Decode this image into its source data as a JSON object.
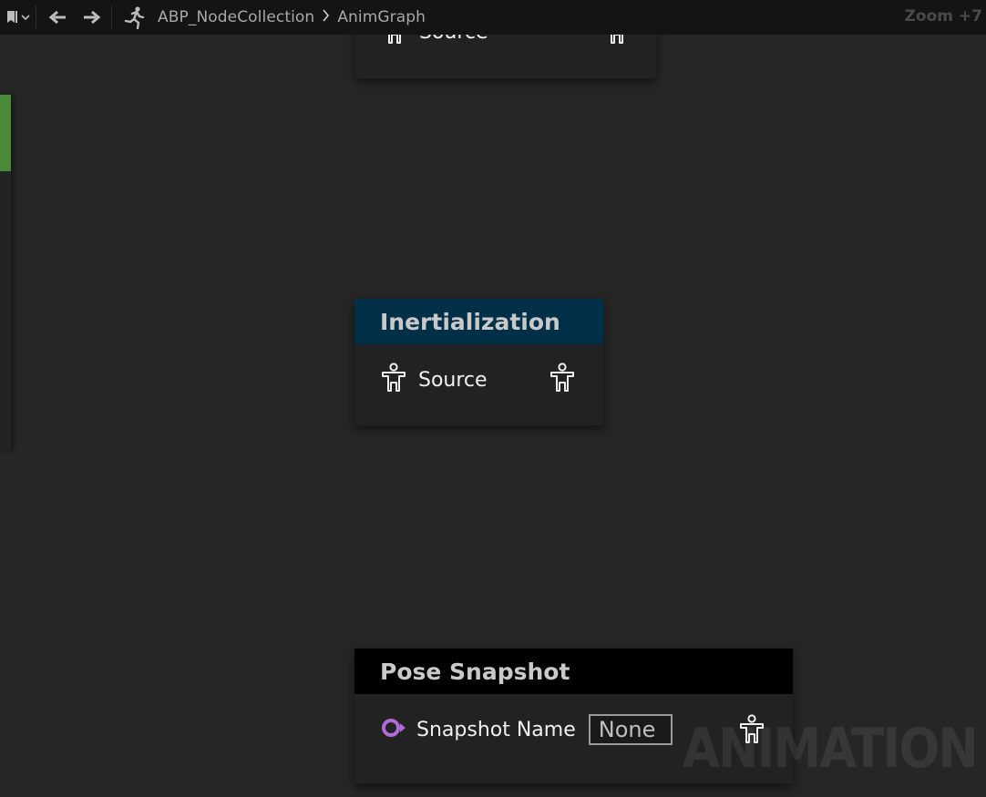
{
  "toolbar": {
    "breadcrumb_root": "ABP_NodeCollection",
    "breadcrumb_separator": ">",
    "breadcrumb_current": "AnimGraph",
    "zoom_label": "Zoom +7"
  },
  "nodes": {
    "top_partial": {
      "pin_label": "Source"
    },
    "inertialization": {
      "title": "Inertialization",
      "header_color": "#003047",
      "pin_label": "Source"
    },
    "pose_snapshot": {
      "title": "Pose Snapshot",
      "header_color": "#000000",
      "pin_label": "Snapshot Name",
      "input_value": "None",
      "pin_color": "#b06ad9"
    }
  },
  "graph": {
    "watermark": "ANIMATION",
    "exec_pin_color": "#4a8a3a"
  },
  "icons": [
    "bookmark-icon",
    "chevron-down-icon",
    "back-arrow-icon",
    "forward-arrow-icon",
    "running-man-icon",
    "pose-icon",
    "name-pin-icon"
  ]
}
